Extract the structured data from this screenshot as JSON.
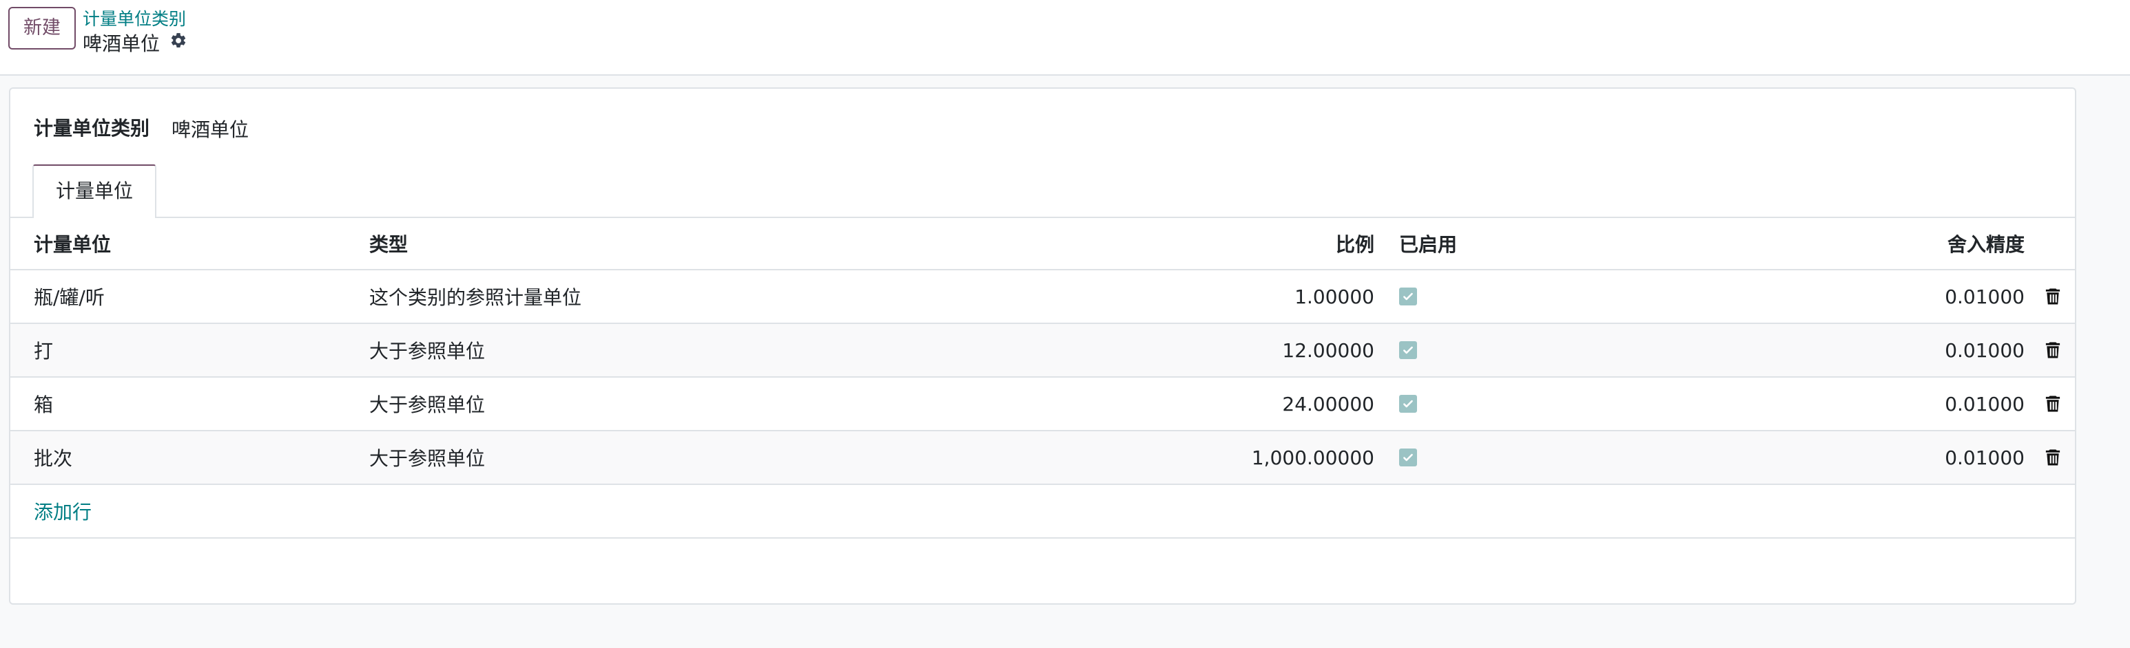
{
  "control_panel": {
    "new_button": "新建",
    "breadcrumb": "计量单位类别",
    "record_title": "啤酒单位"
  },
  "form": {
    "category_label": "计量单位类别",
    "category_value": "啤酒单位",
    "tab_label": "计量单位"
  },
  "table": {
    "headers": {
      "uom": "计量单位",
      "type": "类型",
      "ratio": "比例",
      "active": "已启用",
      "rounding": "舍入精度"
    },
    "rows": [
      {
        "uom": "瓶/罐/听",
        "type": "这个类别的参照计量单位",
        "ratio": "1.00000",
        "active": true,
        "rounding": "0.01000"
      },
      {
        "uom": "打",
        "type": "大于参照单位",
        "ratio": "12.00000",
        "active": true,
        "rounding": "0.01000"
      },
      {
        "uom": "箱",
        "type": "大于参照单位",
        "ratio": "24.00000",
        "active": true,
        "rounding": "0.01000"
      },
      {
        "uom": "批次",
        "type": "大于参照单位",
        "ratio": "1,000.00000",
        "active": true,
        "rounding": "0.01000"
      }
    ],
    "add_line": "添加行"
  },
  "icons": {
    "gear": "gear-icon",
    "trash": "trash-icon",
    "checkbox": "checkbox-checked-icon"
  },
  "colors": {
    "brand": "#714b67",
    "link": "#017e84",
    "checkbox": "#9bc3c4"
  }
}
